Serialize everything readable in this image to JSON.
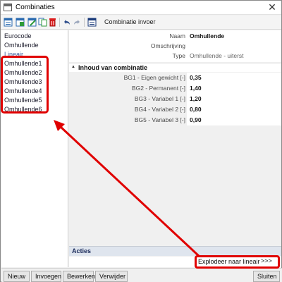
{
  "window": {
    "title": "Combinaties",
    "close_glyph": "✕"
  },
  "toolbar": {
    "icons": [
      "new-icon",
      "insert-icon",
      "edit-icon",
      "copy-icon",
      "delete-icon",
      "undo-icon",
      "redo-icon",
      "table-icon"
    ],
    "label": "Combinatie invoer"
  },
  "left_panel": {
    "items": [
      {
        "label": "Eurocode"
      },
      {
        "label": "Omhullende"
      },
      {
        "label": "Lineair"
      },
      {
        "label": "Omhullende1"
      },
      {
        "label": "Omhullende2"
      },
      {
        "label": "Omhullende3"
      },
      {
        "label": "Omhullende4"
      },
      {
        "label": "Omhullende5"
      },
      {
        "label": "Omhullende6"
      }
    ]
  },
  "properties": {
    "name_label": "Naam",
    "name_value": "Omhullende",
    "description_label": "Omschrijving",
    "description_value": "",
    "type_label": "Type",
    "type_value": "Omhullende - uiterst"
  },
  "section": {
    "title": "Inhoud van combinatie",
    "rows": [
      {
        "label": "BG1 - Eigen gewicht [-]",
        "value": "0,35"
      },
      {
        "label": "BG2 - Permanent [-]",
        "value": "1,40"
      },
      {
        "label": "BG3 - Variabel 1 [-]",
        "value": "1,20"
      },
      {
        "label": "BG4 - Variabel 2 [-]",
        "value": "0,80"
      },
      {
        "label": "BG5 - Variabel 3 [-]",
        "value": "0,90"
      }
    ]
  },
  "actions": {
    "title": "Acties",
    "explode_label": "Explodeer naar lineair",
    "explode_button": ">>>"
  },
  "bottom_bar": {
    "new": "Nieuw",
    "insert": "Invoegen",
    "edit": "Bewerken",
    "delete": "Verwijder",
    "close": "Sluiten"
  },
  "colors": {
    "highlight": "#e00000",
    "list_blue": "#3c5fa0",
    "actions_bg": "#dfe5ee"
  }
}
